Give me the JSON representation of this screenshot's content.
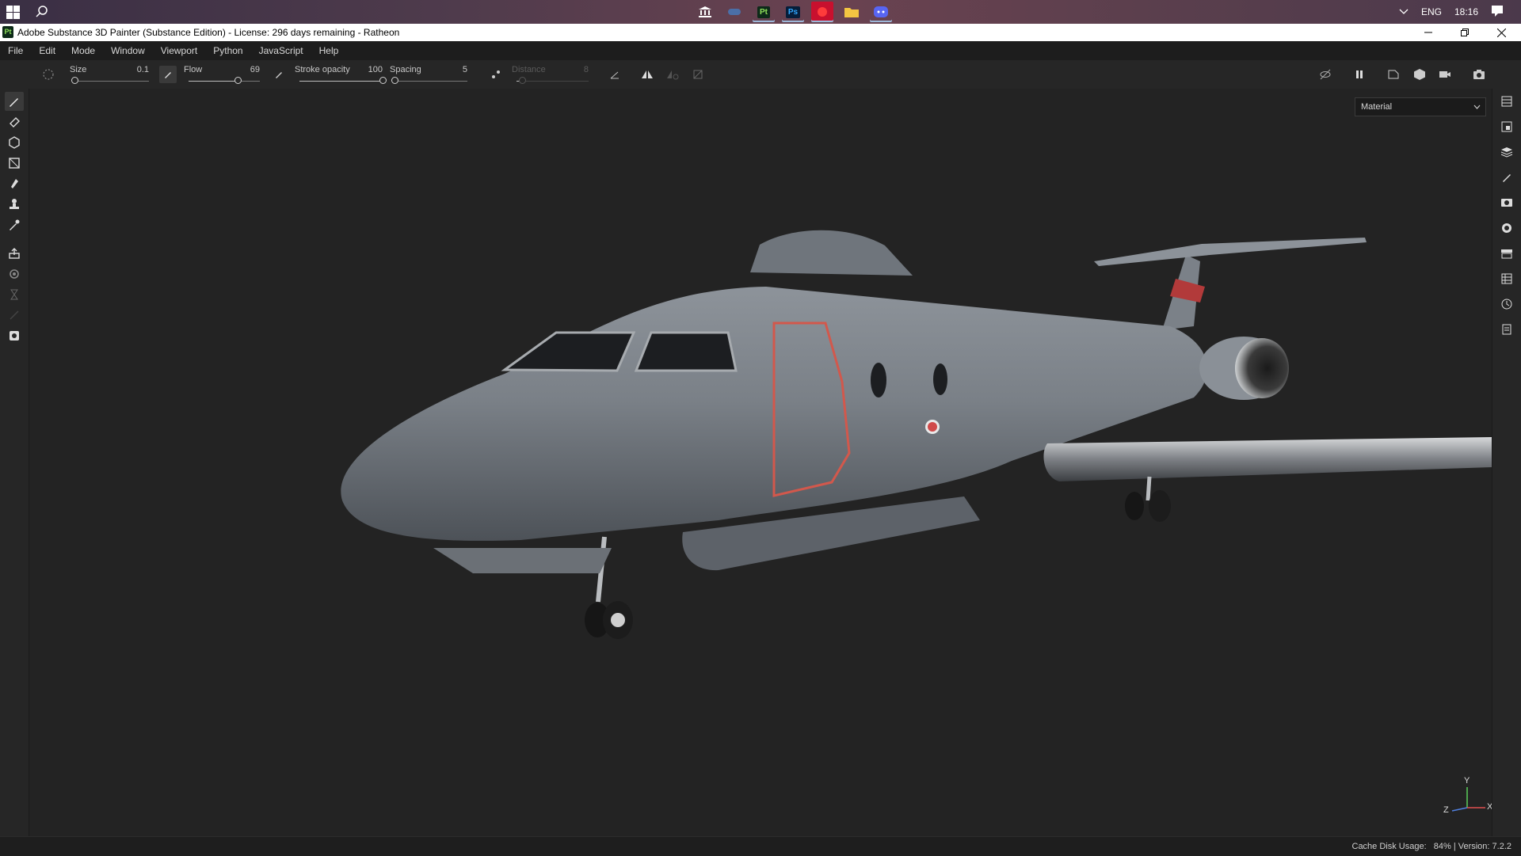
{
  "taskbar": {
    "apps": [
      {
        "name": "bank",
        "label": ""
      },
      {
        "name": "controller",
        "label": ""
      },
      {
        "name": "painter",
        "label": "Pt"
      },
      {
        "name": "photoshop",
        "label": "Ps"
      },
      {
        "name": "red-app",
        "label": ""
      },
      {
        "name": "explorer",
        "label": ""
      },
      {
        "name": "discord",
        "label": ""
      }
    ],
    "tray": {
      "language": "ENG",
      "time": "18:16"
    }
  },
  "window": {
    "app_icon_text": "Pt",
    "title": "Adobe Substance 3D Painter (Substance Edition) - License: 296 days remaining - Ratheon"
  },
  "menu": [
    "File",
    "Edit",
    "Mode",
    "Window",
    "Viewport",
    "Python",
    "JavaScript",
    "Help"
  ],
  "toolbar": {
    "size": {
      "label": "Size",
      "value": "0.1",
      "level": 0.0
    },
    "flow": {
      "label": "Flow",
      "value": "69",
      "level": 0.69
    },
    "stroke_opacity": {
      "label": "Stroke opacity",
      "value": "100",
      "level": 1.0
    },
    "spacing": {
      "label": "Spacing",
      "value": "5",
      "level": 0.0
    },
    "distance": {
      "label": "Distance",
      "value": "8",
      "level": 0.08
    }
  },
  "viewport": {
    "channel_select": "Material",
    "gizmo_labels": {
      "x": "X",
      "y": "Y",
      "z": "Z"
    },
    "background": "#232323"
  },
  "status": {
    "cache_label": "Cache Disk Usage:",
    "cache_value": "84%",
    "version": "| Version: 7.2.2"
  },
  "colors": {
    "accent": "#8fe05a",
    "selection": "#3a3a3a",
    "panel": "#262626"
  }
}
